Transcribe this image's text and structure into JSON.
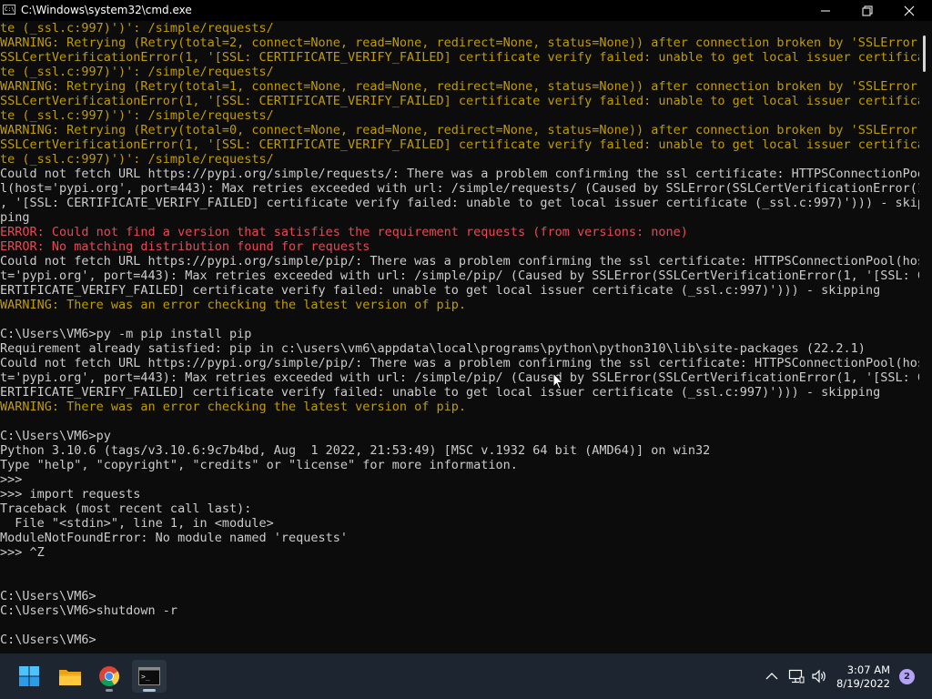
{
  "window": {
    "title": "C:\\Windows\\system32\\cmd.exe",
    "icon_text": "C:\\",
    "controls": [
      "minimize-icon",
      "maximize-icon",
      "close-icon"
    ]
  },
  "console": {
    "lines": [
      {
        "text": "te (_ssl.c:997)')': /simple/requests/",
        "kind": "warn"
      },
      {
        "text": "WARNING: Retrying (Retry(total=2, connect=None, read=None, redirect=None, status=None)) after connection broken by 'SSLError(",
        "kind": "warn"
      },
      {
        "text": "SSLCertVerificationError(1, '[SSL: CERTIFICATE_VERIFY_FAILED] certificate verify failed: unable to get local issuer certifica",
        "kind": "warn"
      },
      {
        "text": "te (_ssl.c:997)')': /simple/requests/",
        "kind": "warn"
      },
      {
        "text": "WARNING: Retrying (Retry(total=1, connect=None, read=None, redirect=None, status=None)) after connection broken by 'SSLError(",
        "kind": "warn"
      },
      {
        "text": "SSLCertVerificationError(1, '[SSL: CERTIFICATE_VERIFY_FAILED] certificate verify failed: unable to get local issuer certifica",
        "kind": "warn"
      },
      {
        "text": "te (_ssl.c:997)')': /simple/requests/",
        "kind": "warn"
      },
      {
        "text": "WARNING: Retrying (Retry(total=0, connect=None, read=None, redirect=None, status=None)) after connection broken by 'SSLError(",
        "kind": "warn"
      },
      {
        "text": "SSLCertVerificationError(1, '[SSL: CERTIFICATE_VERIFY_FAILED] certificate verify failed: unable to get local issuer certifica",
        "kind": "warn"
      },
      {
        "text": "te (_ssl.c:997)')': /simple/requests/",
        "kind": "warn"
      },
      {
        "text": "Could not fetch URL https://pypi.org/simple/requests/: There was a problem confirming the ssl certificate: HTTPSConnectionPoo",
        "kind": "out"
      },
      {
        "text": "l(host='pypi.org', port=443): Max retries exceeded with url: /simple/requests/ (Caused by SSLError(SSLCertVerificationError(1",
        "kind": "out"
      },
      {
        "text": ", '[SSL: CERTIFICATE_VERIFY_FAILED] certificate verify failed: unable to get local issuer certificate (_ssl.c:997)'))) - skip",
        "kind": "out"
      },
      {
        "text": "ping",
        "kind": "out"
      },
      {
        "text": "ERROR: Could not find a version that satisfies the requirement requests (from versions: none)",
        "kind": "err"
      },
      {
        "text": "ERROR: No matching distribution found for requests",
        "kind": "err"
      },
      {
        "text": "Could not fetch URL https://pypi.org/simple/pip/: There was a problem confirming the ssl certificate: HTTPSConnectionPool(hos",
        "kind": "out"
      },
      {
        "text": "t='pypi.org', port=443): Max retries exceeded with url: /simple/pip/ (Caused by SSLError(SSLCertVerificationError(1, '[SSL: C",
        "kind": "out"
      },
      {
        "text": "ERTIFICATE_VERIFY_FAILED] certificate verify failed: unable to get local issuer certificate (_ssl.c:997)'))) - skipping",
        "kind": "out"
      },
      {
        "text": "WARNING: There was an error checking the latest version of pip.",
        "kind": "warn"
      },
      {
        "text": "",
        "kind": "out"
      },
      {
        "text": "C:\\Users\\VM6>py -m pip install pip",
        "kind": "out"
      },
      {
        "text": "Requirement already satisfied: pip in c:\\users\\vm6\\appdata\\local\\programs\\python\\python310\\lib\\site-packages (22.2.1)",
        "kind": "out"
      },
      {
        "text": "Could not fetch URL https://pypi.org/simple/pip/: There was a problem confirming the ssl certificate: HTTPSConnectionPool(hos",
        "kind": "out"
      },
      {
        "text": "t='pypi.org', port=443): Max retries exceeded with url: /simple/pip/ (Caused by SSLError(SSLCertVerificationError(1, '[SSL: C",
        "kind": "out"
      },
      {
        "text": "ERTIFICATE_VERIFY_FAILED] certificate verify failed: unable to get local issuer certificate (_ssl.c:997)'))) - skipping",
        "kind": "out"
      },
      {
        "text": "WARNING: There was an error checking the latest version of pip.",
        "kind": "warn"
      },
      {
        "text": "",
        "kind": "out"
      },
      {
        "text": "C:\\Users\\VM6>py",
        "kind": "out"
      },
      {
        "text": "Python 3.10.6 (tags/v3.10.6:9c7b4bd, Aug  1 2022, 21:53:49) [MSC v.1932 64 bit (AMD64)] on win32",
        "kind": "out"
      },
      {
        "text": "Type \"help\", \"copyright\", \"credits\" or \"license\" for more information.",
        "kind": "out"
      },
      {
        "text": ">>>",
        "kind": "out"
      },
      {
        "text": ">>> import requests",
        "kind": "out"
      },
      {
        "text": "Traceback (most recent call last):",
        "kind": "out"
      },
      {
        "text": "  File \"<stdin>\", line 1, in <module>",
        "kind": "out"
      },
      {
        "text": "ModuleNotFoundError: No module named 'requests'",
        "kind": "out"
      },
      {
        "text": ">>> ^Z",
        "kind": "out"
      },
      {
        "text": "",
        "kind": "out"
      },
      {
        "text": "",
        "kind": "out"
      },
      {
        "text": "C:\\Users\\VM6>",
        "kind": "out"
      },
      {
        "text": "C:\\Users\\VM6>shutdown -r",
        "kind": "out"
      },
      {
        "text": "",
        "kind": "out"
      },
      {
        "text": "C:\\Users\\VM6>",
        "kind": "out"
      }
    ]
  },
  "colors": {
    "console_bg": "#0c0c0c",
    "console_fg": "#cccccc",
    "warning": "#c19c00",
    "error": "#e74856",
    "taskbar_bg": "#1c2530"
  },
  "taskbar": {
    "apps": [
      {
        "name": "start-icon",
        "active": false
      },
      {
        "name": "file-explorer-icon",
        "active": false
      },
      {
        "name": "chrome-icon",
        "active": false
      },
      {
        "name": "terminal-icon",
        "active": true
      }
    ],
    "tray": [
      "chevron-up-icon",
      "network-icon",
      "volume-icon"
    ],
    "clock": {
      "time": "3:07 AM",
      "date": "8/19/2022"
    },
    "notification_count": "2"
  }
}
